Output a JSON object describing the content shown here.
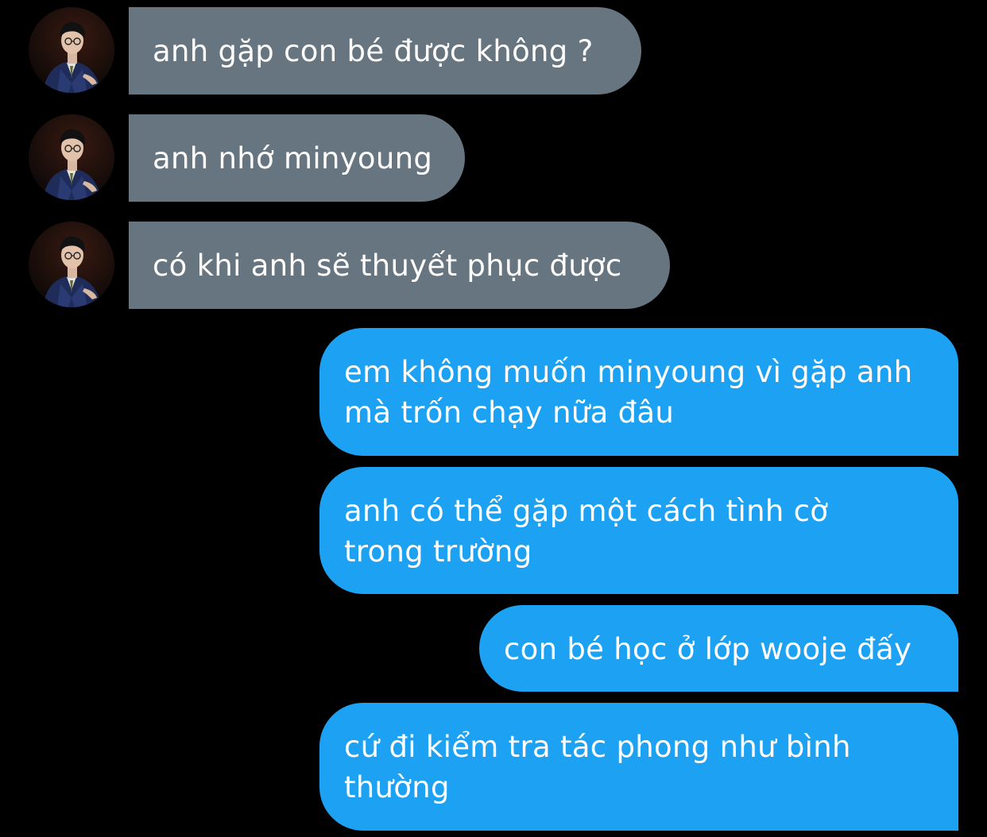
{
  "conversation": {
    "incoming": [
      {
        "text": "anh gặp con bé được không ?"
      },
      {
        "text": "anh nhớ minyoung"
      },
      {
        "text": "có khi anh sẽ thuyết phục được"
      }
    ],
    "outgoing": [
      {
        "line1": "em không muốn minyoung vì gặp anh",
        "line2": "mà trốn chạy nữa đâu"
      },
      {
        "line1": "anh có thể gặp một cách tình cờ",
        "line2": "trong trường"
      },
      {
        "line1": "con bé học ở lớp wooje đấy"
      },
      {
        "line1": "cứ đi kiểm tra tác phong như bình",
        "line2": "thường"
      }
    ]
  },
  "colors": {
    "background": "#000000",
    "incoming_bubble": "#66757f",
    "outgoing_bubble": "#1da1f2",
    "text": "#ffffff"
  },
  "icons": {
    "avatar": "contact-avatar-photo"
  }
}
